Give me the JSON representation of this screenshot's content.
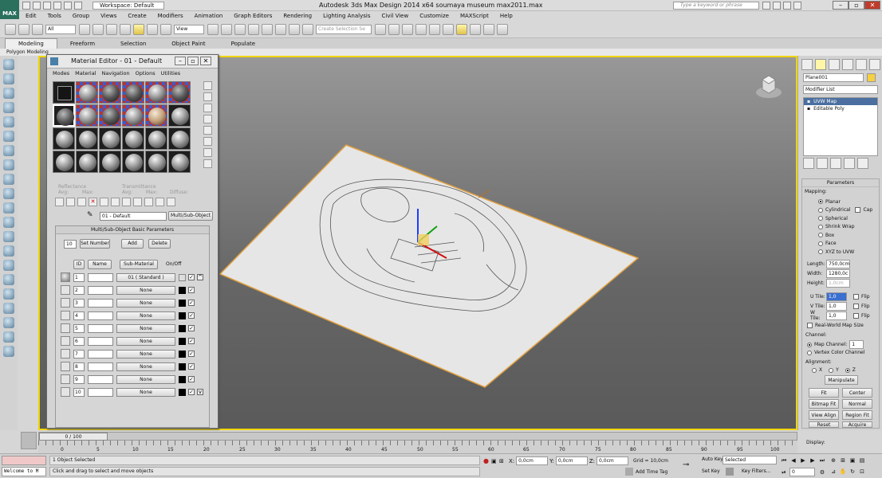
{
  "app": {
    "logo_text": "MAX",
    "title": "Autodesk 3ds Max Design 2014 x64      soumaya museum max2011.max",
    "workspace": "Workspace: Default",
    "search_placeholder": "Type a keyword or phrase"
  },
  "menu": [
    "Edit",
    "Tools",
    "Group",
    "Views",
    "Create",
    "Modifiers",
    "Animation",
    "Graph Editors",
    "Rendering",
    "Lighting Analysis",
    "Civil View",
    "Customize",
    "MAXScript",
    "Help"
  ],
  "toolbar": {
    "selection_filter": "All",
    "reference_coord": "View",
    "named_selection_placeholder": "Create Selection Se"
  },
  "ribbon": {
    "tabs": [
      "Modeling",
      "Freeform",
      "Selection",
      "Object Paint",
      "Populate"
    ],
    "active_tab": "Modeling",
    "sub_label": "Polygon Modeling"
  },
  "material_editor": {
    "title": "Material Editor - 01 - Default",
    "menu": [
      "Modes",
      "Material",
      "Navigation",
      "Options",
      "Utilities"
    ],
    "ghost_labels": {
      "reflectance": "Reflectance",
      "avg1": "Avg:",
      "max1": "Max:",
      "transmittance": "Transmittance",
      "avg2": "Avg:",
      "max2": "Max:",
      "diffuse": "Diffuse:"
    },
    "material_name": "01 - Default",
    "material_type": "Multi/Sub-Object",
    "panel": {
      "title": "Multi/Sub-Object Basic Parameters",
      "count": "10",
      "set_number": "Set Number",
      "add": "Add",
      "delete": "Delete",
      "col_id": "ID",
      "col_name": "Name",
      "col_sub": "Sub-Material",
      "col_onoff": "On/Off",
      "rows": [
        {
          "id": "1",
          "sub": "01 ( Standard )"
        },
        {
          "id": "2",
          "sub": "None"
        },
        {
          "id": "3",
          "sub": "None"
        },
        {
          "id": "4",
          "sub": "None"
        },
        {
          "id": "5",
          "sub": "None"
        },
        {
          "id": "6",
          "sub": "None"
        },
        {
          "id": "7",
          "sub": "None"
        },
        {
          "id": "8",
          "sub": "None"
        },
        {
          "id": "9",
          "sub": "None"
        },
        {
          "id": "10",
          "sub": "None"
        }
      ]
    }
  },
  "command_panel": {
    "object_name": "Plane001",
    "modifier_list": "Modifier List",
    "stack": [
      "UVW Map",
      "Editable Poly"
    ],
    "params_title": "Parameters",
    "mapping_label": "Mapping:",
    "mapping": [
      "Planar",
      "Cylindrical",
      "Spherical",
      "Shrink Wrap",
      "Box",
      "Face",
      "XYZ to UVW"
    ],
    "cap": "Cap",
    "length_label": "Length:",
    "length": "750,0cm",
    "width_label": "Width:",
    "width": "1280,0c",
    "height_label": "Height:",
    "height": "1,0cm",
    "utile_label": "U Tile:",
    "utile": "1,0",
    "vtile_label": "V Tile:",
    "vtile": "1,0",
    "wtile_label": "W Tile:",
    "wtile": "1,0",
    "flip": "Flip",
    "real_world": "Real-World Map Size",
    "channel_label": "Channel:",
    "map_channel": "Map Channel:",
    "map_channel_value": "1",
    "vertex_color_channel": "Vertex Color Channel",
    "alignment_label": "Alignment:",
    "axes": [
      "X",
      "Y",
      "Z"
    ],
    "buttons": [
      "Manipulate",
      "Fit",
      "Center",
      "Bitmap Fit",
      "Normal Align",
      "View Align",
      "Region Fit",
      "Reset",
      "Acquire"
    ],
    "display_label": "Display:"
  },
  "timeline": {
    "frame": "0 / 100",
    "ticks": [
      "0",
      "5",
      "10",
      "15",
      "20",
      "25",
      "30",
      "35",
      "40",
      "45",
      "50",
      "55",
      "60",
      "65",
      "70",
      "75",
      "80",
      "85",
      "90",
      "95",
      "100"
    ]
  },
  "status": {
    "welcome": "Welcome to M",
    "objects_selected": "1 Object Selected",
    "prompt": "Click and drag to select and move objects",
    "x": "0,0cm",
    "y": "0,0cm",
    "z": "0,0cm",
    "grid": "Grid = 10,0cm",
    "add_time_tag": "Add Time Tag",
    "auto_key": "Auto Key",
    "set_key": "Set Key",
    "selected": "Selected",
    "key_filters": "Key Filters...",
    "current_frame": "0"
  },
  "colors": {
    "viewport_border": "#f0d500",
    "plane": "#e6e6e6",
    "plane_edge": "#e0a040"
  }
}
